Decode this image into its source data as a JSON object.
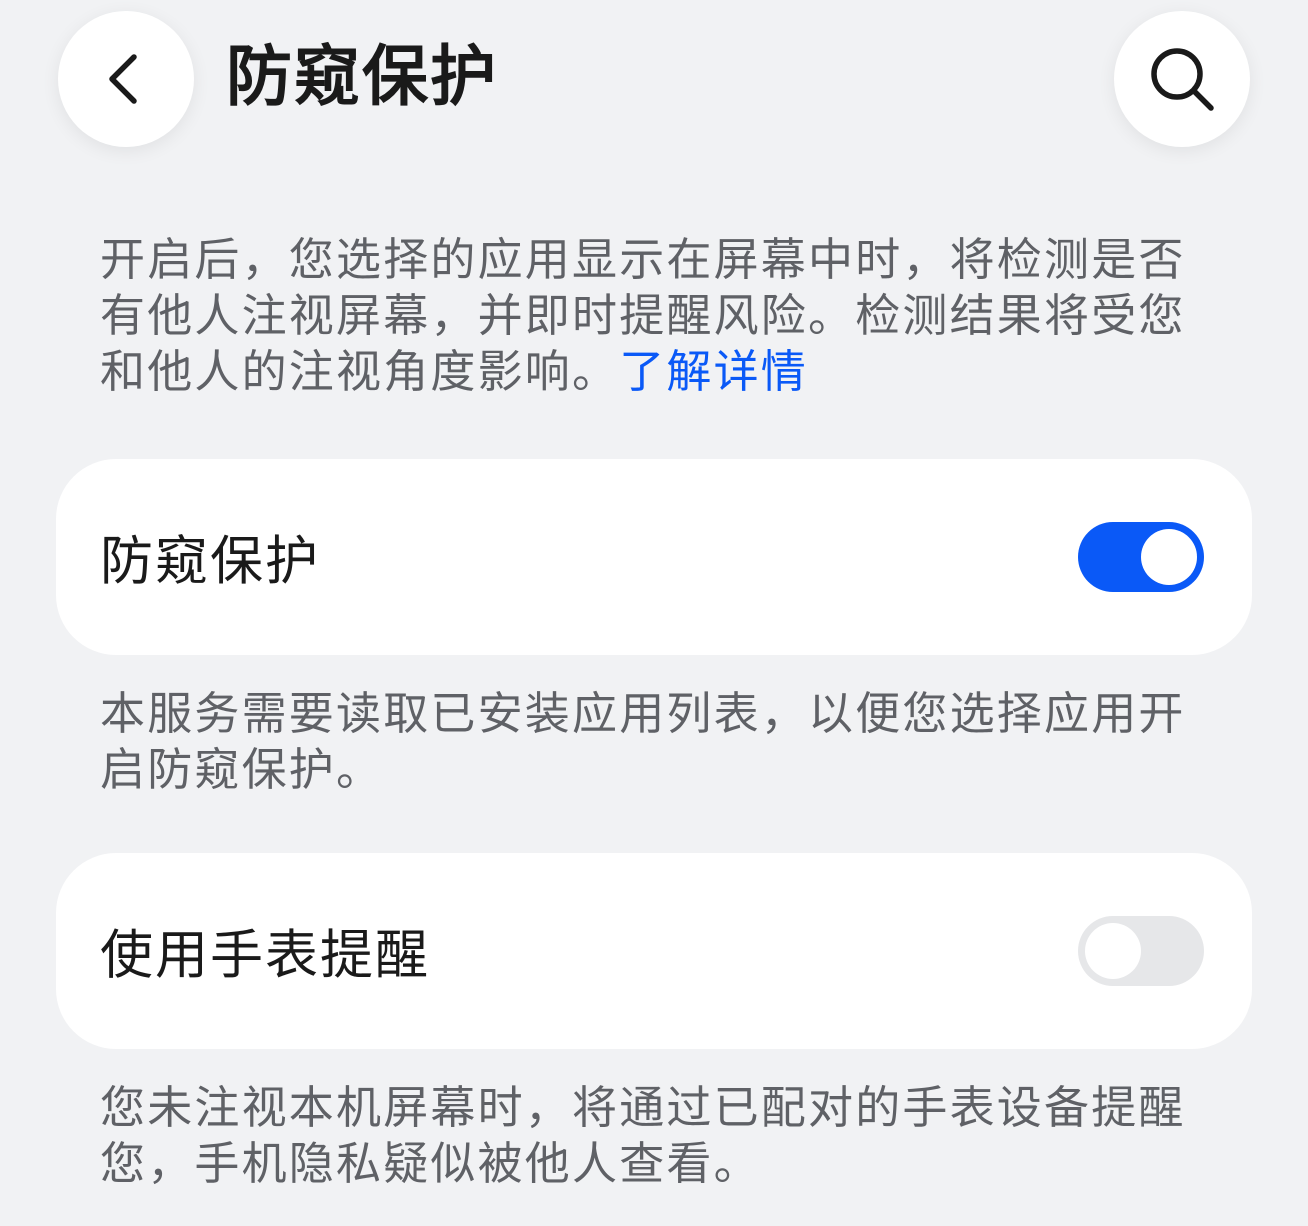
{
  "header": {
    "back_icon": "chevron-left-icon",
    "title": "防窥保护",
    "search_icon": "search-icon"
  },
  "intro": {
    "text": "开启后，您选择的应用显示在屏幕中时，将检测是否有他人注视屏幕，并即时提醒风险。检测结果将受您和他人的注视角度影响。",
    "link_text": "了解详情"
  },
  "settings": [
    {
      "label": "防窥保护",
      "enabled": true,
      "description": "本服务需要读取已安装应用列表，以便您选择应用开启防窥保护。"
    },
    {
      "label": "使用手表提醒",
      "enabled": false,
      "description": "您未注视本机屏幕时，将通过已配对的手表设备提醒您，手机隐私疑似被他人查看。"
    }
  ],
  "colors": {
    "accent": "#0a59f7",
    "background": "#f1f2f4",
    "card": "#ffffff",
    "toggle_off": "#e6e7e9",
    "secondary_text": "#5f6166"
  }
}
